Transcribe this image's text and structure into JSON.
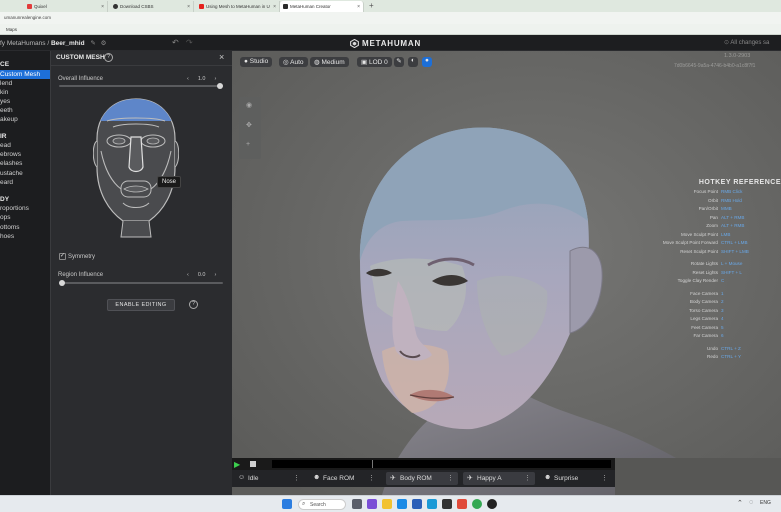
{
  "browser": {
    "tabs": [
      {
        "label": "Quixel",
        "color": "#e23b3b",
        "active": false
      },
      {
        "label": "Download CSBS",
        "color": "#333333",
        "active": false
      },
      {
        "label": "Using Mesh to MetaHuman in U",
        "color": "#e5211d",
        "active": false
      },
      {
        "label": "MetaHuman Creator",
        "color": "#2b2b2b",
        "active": true
      }
    ],
    "tab_close": "×",
    "new_tab": "+",
    "url": "umanunrealengine.com",
    "bookmark": "Maps"
  },
  "app": {
    "breadcrumb_prefix": "fy MetaHumans /",
    "breadcrumb_file": "Beer_mhid",
    "logo_text": "METAHUMAN",
    "saved_status": "All changes sa"
  },
  "nav": {
    "face_header": "CE",
    "face_items": [
      "Custom Mesh",
      "lend",
      "kin",
      "yes",
      "eeth",
      "akeup"
    ],
    "hair_header": "IR",
    "hair_items": [
      "ead",
      "ebrows",
      "elashes",
      "ustache",
      "eard"
    ],
    "body_header": "DY",
    "body_items": [
      "roportions",
      "ops",
      "ottoms",
      "hoes"
    ]
  },
  "panel": {
    "title": "CUSTOM MESH",
    "help": "?",
    "close": "×",
    "overall_label": "Overall Influence",
    "overall_value": "1.0",
    "overall_fraction": 1.0,
    "region_label": "Region Influence",
    "region_value": "0.0",
    "region_fraction": 0.0,
    "symmetry_label": "Symmetry",
    "symmetry_checked": true,
    "enable_button": "ENABLE EDITING",
    "hover_region": "Nose",
    "stepper_left": "‹",
    "stepper_right": "›"
  },
  "viewport": {
    "buttons": {
      "studio": "Studio",
      "auto": "Auto",
      "medium": "Medium",
      "lod": "LOD 0"
    },
    "version": "1.3.0-2903",
    "asset_id": "7d0b6645-9a5a-4746-b4b0-a1c8f7f1",
    "hotkey_title": "HOTKEY REFERENCE",
    "hotkeys": [
      [
        "Focus Point",
        "RMB Click"
      ],
      [
        "Orbit",
        "RMB Hold"
      ],
      [
        "Pan/Orbit",
        "MMB"
      ],
      [
        "Pan",
        "ALT + RMB"
      ],
      [
        "Zoom",
        "ALT + RMB"
      ],
      [
        "Move Sculpt Point",
        "LMB"
      ],
      [
        "Move Sculpt Point Forward",
        "CTRL + LMB"
      ],
      [
        "Reset Sculpt Point",
        "SHIFT + LMB"
      ],
      [
        "Rotate Lights",
        "L + Mouse"
      ],
      [
        "Reset Lights",
        "SHIFT + L"
      ],
      [
        "Toggle Clay Render",
        "C"
      ],
      [
        "Face Camera",
        "1"
      ],
      [
        "Body Camera",
        "2"
      ],
      [
        "Torso Camera",
        "3"
      ],
      [
        "Legs Camera",
        "4"
      ],
      [
        "Feet Camera",
        "5"
      ],
      [
        "Far Camera",
        "6"
      ],
      [
        "Undo",
        "CTRL + Z"
      ],
      [
        "Redo",
        "CTRL + Y"
      ]
    ],
    "animations": [
      "Idle",
      "Face ROM",
      "Body ROM",
      "Happy A",
      "Surprise"
    ],
    "menu_dots": "⋮"
  },
  "taskbar": {
    "search": "Search",
    "lang": "ENG"
  },
  "colors": {
    "accent": "#1d6fd8",
    "hotkey_value": "#69a8e8",
    "play": "#3ccf4e"
  }
}
